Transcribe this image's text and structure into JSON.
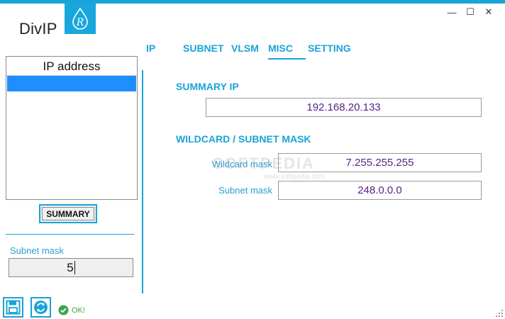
{
  "app": {
    "title": "DivIP",
    "logo_letter": "R"
  },
  "window_controls": {
    "minimize": "—",
    "maximize": "☐",
    "close": "✕"
  },
  "sidebar": {
    "list_header": "IP address",
    "summary_button": "SUMMARY",
    "subnet_mask_label": "Subnet mask",
    "subnet_mask_value": "5"
  },
  "tabs": [
    {
      "label": "IP"
    },
    {
      "label": "SUBNET"
    },
    {
      "label": "VLSM"
    },
    {
      "label": "MISC",
      "active": true
    },
    {
      "label": "SETTING"
    }
  ],
  "misc": {
    "summary_ip_title": "SUMMARY IP",
    "summary_ip_value": "192.168.20.133",
    "wildcard_section_title": "WILDCARD / SUBNET MASK",
    "wildcard_label": "Wildcard mask",
    "wildcard_value": "7.255.255.255",
    "subnet_label": "Subnet mask",
    "subnet_value": "248.0.0.0"
  },
  "watermark": {
    "text": "SOFTPEDIA",
    "sub": "www.softpedia.com"
  },
  "status": {
    "text": "OK!"
  },
  "colors": {
    "accent": "#1aa3d6",
    "value_text": "#5a1e86",
    "selection": "#1e8fff",
    "ok": "#3aa64a"
  }
}
